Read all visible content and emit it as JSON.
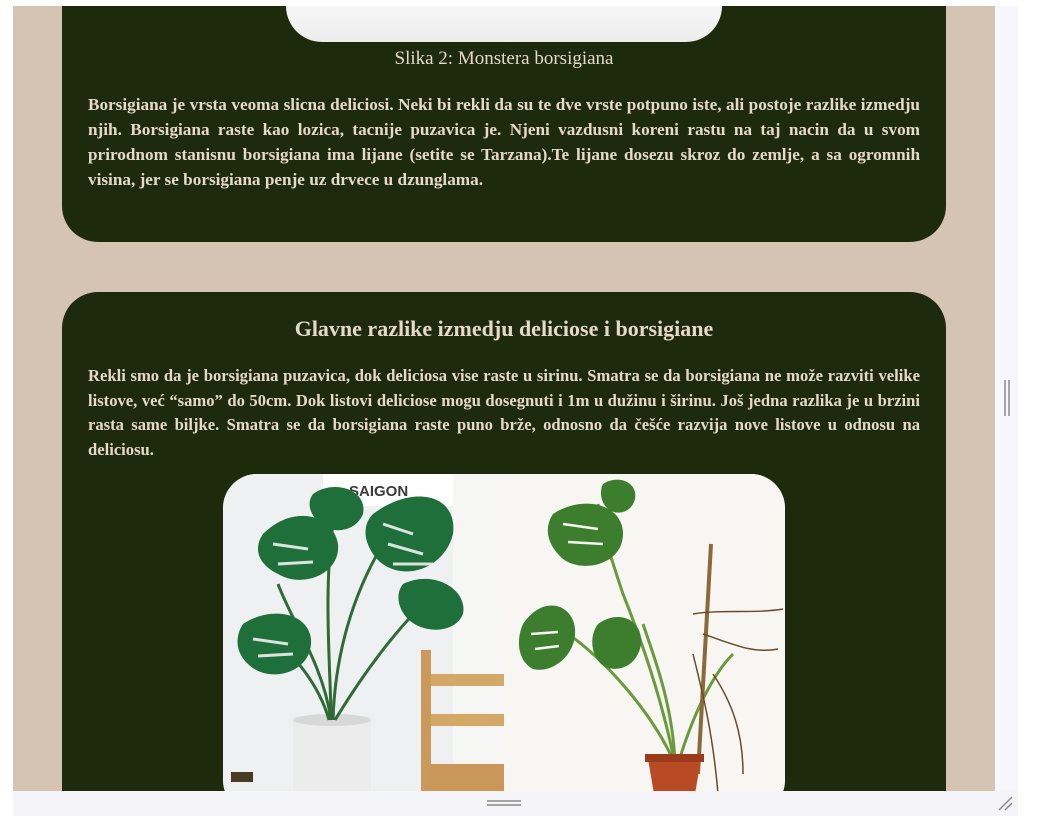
{
  "section_one": {
    "caption": "Slika 2: Monstera borsigiana",
    "paragraph": "Borsigiana je vrsta veoma slicna deliciosi. Neki bi rekli da su te dve vrste potpuno iste, ali postoje razlike izmedju njih. Borsigiana raste kao lozica, tacnije puzavica je. Njeni vazdusni koreni rastu na taj nacin da u svom prirodnom stanisnu borsigiana ima lijane (setite se Tarzana).Te lijane dosezu skroz do zemlje, a sa ogromnih visina, jer se borsigiana penje uz drvece u dzunglama."
  },
  "section_two": {
    "heading": "Glavne razlike izmedju deliciose i borsigiane",
    "paragraph": "Rekli smo da je borsigiana puzavica, dok deliciosa vise raste u sirinu. Smatra se da borsigiana ne može razviti velike listove, već “samo” do 50cm. Dok listovi deliciose mogu dosegnuti i 1m u dužinu i širinu. Još jedna razlika je u brzini rasta same biljke. Smatra se da borsigiana raste puno brže, odnosno da češće razvija nove listove u odnosu na deliciosu.",
    "photo_sign": "SAIGON"
  },
  "colors": {
    "page_background": "#d5c4b4",
    "card_background": "#1d2a0b",
    "text": "#e6d9c8"
  },
  "icons": [
    "vertical-resize-handle-icon",
    "horizontal-resize-handle-icon",
    "resize-grip-icon"
  ]
}
